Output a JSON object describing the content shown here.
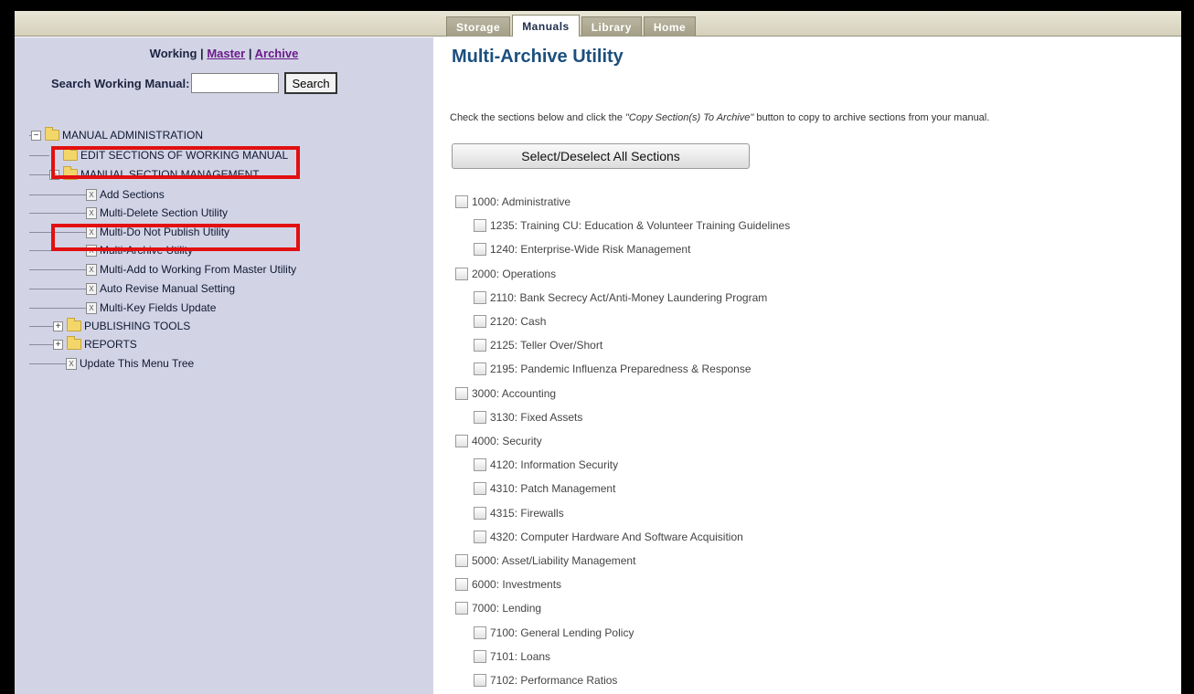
{
  "topnav": {
    "tabs": [
      "Storage",
      "Manuals",
      "Library",
      "Home"
    ],
    "active": "Manuals"
  },
  "left": {
    "working_label": "Working",
    "sep1": " | ",
    "master_link": "Master",
    "sep2": " | ",
    "archive_link": "Archive",
    "search_label": "Search Working Manual:",
    "search_value": "",
    "search_button": "Search"
  },
  "tree": [
    {
      "label": "MANUAL ADMINISTRATION",
      "type": "folder",
      "toggle": "−"
    },
    {
      "label": "EDIT SECTIONS OF WORKING MANUAL",
      "type": "folder",
      "toggle": ""
    },
    {
      "label": "MANUAL SECTION MANAGEMENT",
      "type": "folder",
      "toggle": "−"
    },
    {
      "label": "Add Sections",
      "type": "page"
    },
    {
      "label": "Multi-Delete Section Utility",
      "type": "page"
    },
    {
      "label": "Multi-Do Not Publish Utility",
      "type": "page"
    },
    {
      "label": "Multi-Archive Utility",
      "type": "page"
    },
    {
      "label": "Multi-Add to Working From Master Utility",
      "type": "page"
    },
    {
      "label": "Auto Revise Manual Setting",
      "type": "page"
    },
    {
      "label": "Multi-Key Fields Update",
      "type": "page"
    },
    {
      "label": "PUBLISHING TOOLS",
      "type": "folder",
      "toggle": "+"
    },
    {
      "label": "REPORTS",
      "type": "folder",
      "toggle": "+"
    },
    {
      "label": "Update This Menu Tree",
      "type": "page"
    }
  ],
  "main": {
    "title": "Multi-Archive Utility",
    "instr_before": "Check the sections below and click the ",
    "instr_em": "\"Copy Section(s) To Archive\"",
    "instr_after": " button to copy to archive sections from your manual.",
    "select_all_button": "Select/Deselect All Sections",
    "sections": [
      {
        "label": "1000: Administrative",
        "level": 0
      },
      {
        "label": "1235: Training CU: Education & Volunteer Training Guidelines",
        "level": 1
      },
      {
        "label": "1240: Enterprise-Wide Risk Management",
        "level": 1
      },
      {
        "label": "2000: Operations",
        "level": 0
      },
      {
        "label": "2110: Bank Secrecy Act/Anti-Money Laundering Program",
        "level": 1
      },
      {
        "label": "2120: Cash",
        "level": 1
      },
      {
        "label": "2125: Teller Over/Short",
        "level": 1
      },
      {
        "label": "2195: Pandemic Influenza Preparedness & Response",
        "level": 1
      },
      {
        "label": "3000: Accounting",
        "level": 0
      },
      {
        "label": "3130: Fixed Assets",
        "level": 1
      },
      {
        "label": "4000: Security",
        "level": 0
      },
      {
        "label": "4120: Information Security",
        "level": 1
      },
      {
        "label": "4310: Patch Management",
        "level": 1
      },
      {
        "label": "4315: Firewalls",
        "level": 1
      },
      {
        "label": "4320: Computer Hardware And Software Acquisition",
        "level": 1
      },
      {
        "label": "5000: Asset/Liability Management",
        "level": 0
      },
      {
        "label": "6000: Investments",
        "level": 0
      },
      {
        "label": "7000: Lending",
        "level": 0
      },
      {
        "label": "7100: General Lending Policy",
        "level": 1
      },
      {
        "label": "7101: Loans",
        "level": 1
      },
      {
        "label": "7102: Performance Ratios",
        "level": 1
      }
    ]
  }
}
